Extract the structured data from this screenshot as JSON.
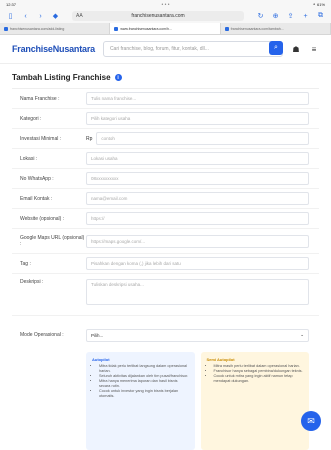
{
  "status": {
    "time": "12:37",
    "date": "Mon 18 Jun",
    "right": "⚬ 61%"
  },
  "browser": {
    "url": "franchisenusantara.com",
    "reader_label": "AA",
    "tabs": [
      {
        "label": "franchisenusantara.com/add-listing"
      },
      {
        "label": "www.franchisenusantara.com/h..."
      },
      {
        "label": "franchisenusantara.com/tambah..."
      }
    ]
  },
  "site": {
    "logo": "FranchiseNusantara",
    "search_placeholder": "Cari franchise, blog, forum, fitur, kontak, dll..."
  },
  "form": {
    "title": "Tambah Listing Franchise",
    "fields": [
      {
        "label": "Nama Franchise :",
        "placeholder": "Tulis nama franchise..."
      },
      {
        "label": "Kategori :",
        "placeholder": "Pilih kategori usaha"
      },
      {
        "label": "Investasi Minimal :",
        "prefix": "Rp",
        "placeholder": "contoh"
      },
      {
        "label": "Lokasi :",
        "placeholder": "Lokasi usaha"
      },
      {
        "label": "No WhatsApp :",
        "placeholder": "08xxxxxxxxxx"
      },
      {
        "label": "Email Kontak :",
        "placeholder": "nama@email.com"
      },
      {
        "label": "Website (opsional) :",
        "placeholder": "https://"
      },
      {
        "label": "Google Maps URL (opsional) :",
        "placeholder": "https://maps.google.com/..."
      },
      {
        "label": "Tag :",
        "placeholder": "Pisahkan dengan koma (,) jika lebih dari satu"
      },
      {
        "label": "Deskripsi :",
        "placeholder": "Tuliskan deskripsi usaha..."
      }
    ],
    "mode": {
      "label": "Mode Operasional :",
      "value": "Pilih..."
    },
    "panel_autopilot": {
      "title": "Autopilot",
      "items": [
        "Mitra tidak perlu terlibat langsung dalam operasional harian.",
        "Seluruh aktivitas dijalankan oleh tim pusat/franchisor.",
        "Mitra hanya menerima laporan dan hasil bisnis secara rutin.",
        "Cocok untuk investor yang ingin bisnis berjalan otomatis."
      ]
    },
    "panel_semi": {
      "title": "Semi Autopilot",
      "items": [
        "Mitra masih perlu terlibat dalam operasional harian.",
        "Franchisor hanya sebagai pembina/dukungan teknis.",
        "Cocok untuk mitra yang ingin aktif namun tetap mendapat dukungan."
      ]
    }
  }
}
